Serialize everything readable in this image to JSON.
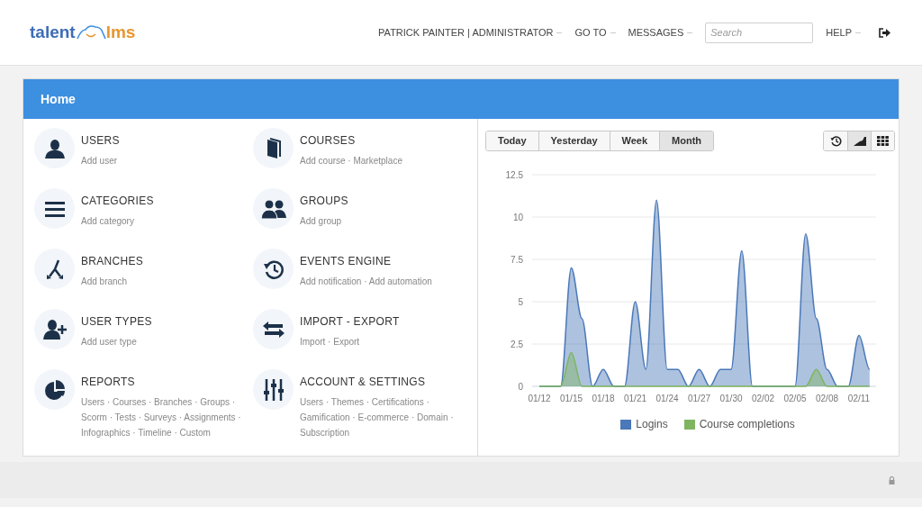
{
  "header": {
    "logo": {
      "part_1": "talent",
      "part_2": "lms"
    },
    "nav": [
      {
        "label": "PATRICK PAINTER | ADMINISTRATOR",
        "dropdown": true
      },
      {
        "label": "GO TO",
        "dropdown": true
      },
      {
        "label": "MESSAGES",
        "dropdown": true
      },
      {
        "kind": "search",
        "placeholder": "Search"
      },
      {
        "label": "HELP",
        "dropdown": true
      },
      {
        "kind": "logout"
      }
    ]
  },
  "panel": {
    "title": "Home",
    "tiles": [
      {
        "title": "USERS",
        "links": "Add user"
      },
      {
        "title": "COURSES",
        "links": "Add course · Marketplace"
      },
      {
        "title": "CATEGORIES",
        "links": "Add category"
      },
      {
        "title": "GROUPS",
        "links": "Add group"
      },
      {
        "title": "BRANCHES",
        "links": "Add branch"
      },
      {
        "title": "EVENTS ENGINE",
        "links": "Add notification · Add automation"
      },
      {
        "title": "USER TYPES",
        "links": "Add user type"
      },
      {
        "title": "IMPORT - EXPORT",
        "links": "Import · Export"
      },
      {
        "title": "REPORTS",
        "links": "Users · Courses · Branches · Groups · Scorm · Tests · Surveys · Assignments · Infographics · Timeline · Custom"
      },
      {
        "title": "ACCOUNT & SETTINGS",
        "links": "Users · Themes · Certifications · Gamification · E-commerce · Domain · Subscription"
      }
    ],
    "periods": [
      {
        "label": "Today",
        "selected": false
      },
      {
        "label": "Yesterday",
        "selected": false
      },
      {
        "label": "Week",
        "selected": false
      },
      {
        "label": "Month",
        "selected": true
      }
    ],
    "views": [
      {
        "kind": "history",
        "selected": false
      },
      {
        "kind": "chart",
        "selected": true
      },
      {
        "kind": "grid",
        "selected": false
      }
    ],
    "chart_data": {
      "type": "area",
      "categories": [
        "01/12",
        null,
        null,
        "01/15",
        null,
        null,
        "01/18",
        null,
        null,
        "01/21",
        null,
        null,
        "01/24",
        null,
        null,
        "01/27",
        null,
        null,
        "01/30",
        null,
        null,
        "02/02",
        null,
        null,
        "02/05",
        null,
        null,
        "02/08",
        null,
        null,
        "02/11",
        null
      ],
      "yticks": [
        {
          "value": 0,
          "label": "0"
        },
        {
          "value": 2.5,
          "label": "2.5"
        },
        {
          "value": 5,
          "label": "5"
        },
        {
          "value": 7.5,
          "label": "7.5"
        },
        {
          "value": 10,
          "label": "10"
        },
        {
          "value": 12.5,
          "label": "12.5"
        }
      ],
      "ylim": [
        0,
        12.5
      ],
      "grid": true,
      "legend": "bottom",
      "series": [
        {
          "name": "Logins",
          "color": "#4a78b8",
          "values": [
            0,
            0,
            0,
            7,
            4,
            0,
            1,
            0,
            0,
            5,
            1,
            11,
            1,
            1,
            0,
            1,
            0,
            1,
            1,
            8,
            0,
            0,
            0,
            0,
            0,
            9,
            4,
            1,
            0,
            0,
            3,
            1
          ]
        },
        {
          "name": "Course completions",
          "color": "#7fb560",
          "values": [
            0,
            0,
            0,
            2,
            0,
            0,
            0,
            0,
            0,
            0,
            0,
            0,
            0,
            0,
            0,
            0,
            0,
            0,
            0,
            0,
            0,
            0,
            0,
            0,
            0,
            0,
            1,
            0,
            0,
            0,
            0,
            0
          ]
        }
      ]
    }
  }
}
